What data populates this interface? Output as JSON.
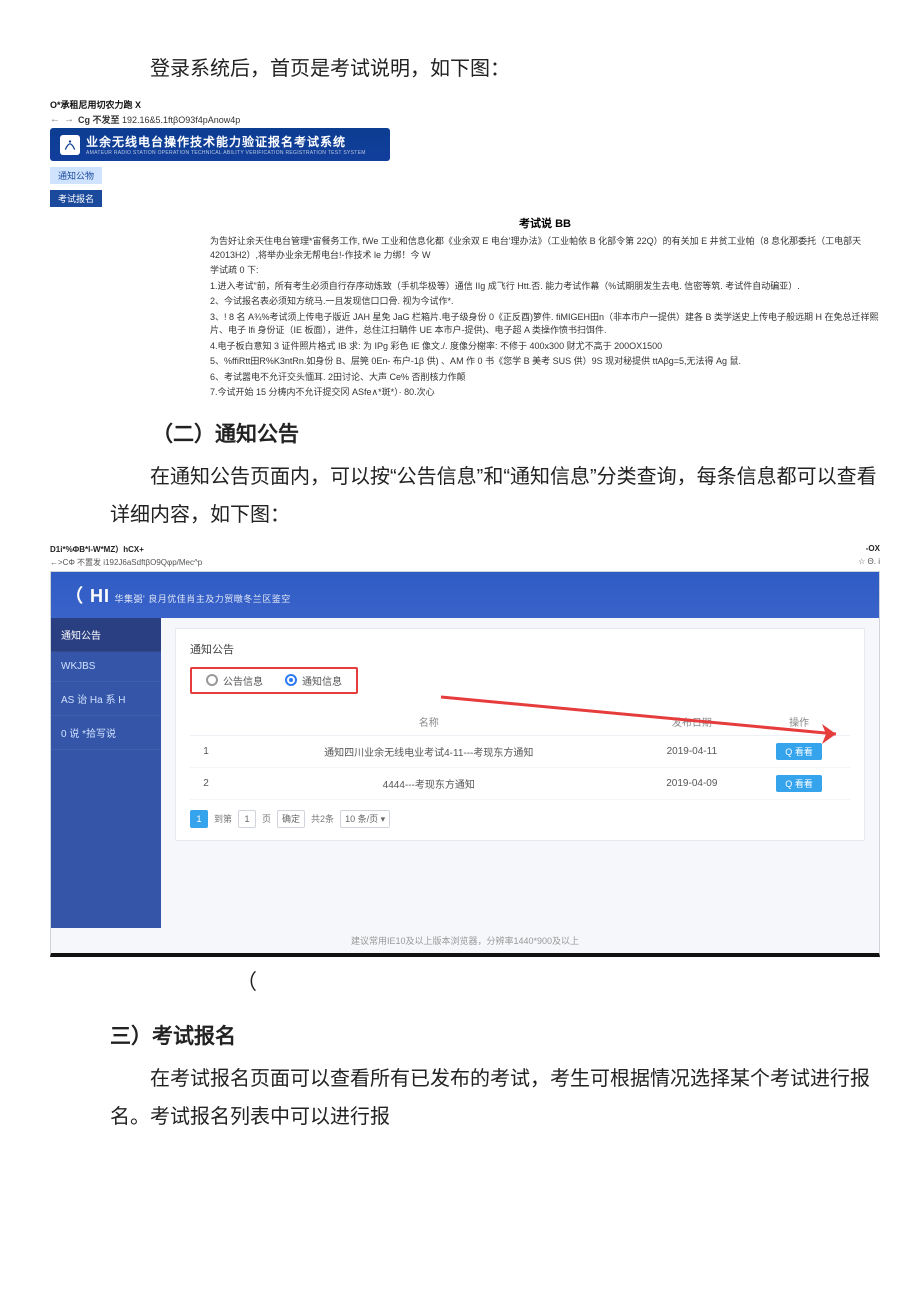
{
  "para_intro": "登录系统后，首页是考试说明，如下图：",
  "shot1": {
    "tab_line": "O*承租尼用切农力跑 X",
    "arrows": {
      "left": "←",
      "right": "→"
    },
    "url_prefix": "Cg 不发至 ",
    "url": "192.16&5.1ftβO93f4pAnow4p",
    "banner_title": "业余无线电台操作技术能力验证报名考试系统",
    "banner_sub": "AMATEUR RADIO STATION OPERATION TECHNICAL ABILITY VERIFICATION REGISTRATION TEST SYSTEM",
    "chip1": "通知公物",
    "chip2": "考试报名",
    "title": "考试说 BB",
    "p1": "为告好让余天住电台管理*宙餐务工作, fWe 工业和信息化都《业余双 E 电台'理办法》（工业帕依 B 化部令第 22Q）的有关加 E 井贫工业帕（8 息化那委托（工电部天 42013H2）,将举办业余无帮电台!-作技术 le 力绑！今 W",
    "p2": "学试疏 0 下:",
    "p3": "1.进入考试\"前，所有考生必须自行存序动炼致（手机华极等）通信 IIg 成飞行 Htt.否. 能力考试作幕（%试期朋发生去电. 信密等筑. 考试件自动碥亚）.",
    "p4": "2、今试报名表必须知方统马.一且发现信口口骨. 视为今试作*.",
    "p5": "3、! 8 名 A¾%考试须上传电子版近 JAH 星免 JaG 栏箱片.电子级身份 0《正反酉)箩件. fiMIGEH田n（非本市户一提供）建各 B 类学送史上传电子般远期 H 在免总迁祥熙片、电子 lfi 身份证（IE 板面），进件，总住江扫聃件 UE 本市户-提供)、电子超 A 类操作愤书扫饵件.",
    "p6": "4.电子板白意知 3 证件照片格式 IB 求: 为 IPg 彩色 IE 像文./. 度像分榭率: 不修于 400x300 财尤不高于 200OX1500",
    "p7": "5、%ffiRtt田R%K3ntRn.如身份 B、层筦 0En- 布户-1β 供) 、AM 作 0 书《您学 B 美考 SUS 供）9S 现对秘提供 ttAβg=5,无法得 Ag 鼠.",
    "p8": "6、考试嚣电不允讦交头愐耳. 2田讨论、大声 Ce% 否削核力作颠",
    "p9": "7.今试开始 15 分梼内不允讦提交冈 ASfe∧*斑*）· 80.次心"
  },
  "heading2": "（二）通知公告",
  "para2": "在通知公告页面内，可以按“公告信息”和“通知信息”分类查询，每条信息都可以查看详细内容，如下图：",
  "shot2": {
    "win_left": "D1i*%ΦB*l-W*MZ）hCX+",
    "win_right": "-OX",
    "url_left": "←>CΦ 不置发 i192J6aSdftβO9Qφp/Mec^p",
    "url_right": "☆ Θ. i",
    "hdr_big": "（ HI",
    "hdr_sub": "华集弼' 良月优佳肖主及力贸暾冬兰区鉴空",
    "side": [
      "通知公告",
      "WKJBS",
      "AS 诒 Ha 系 H",
      "0 说 *拾写说"
    ],
    "card_label": "通知公告",
    "radio1": "公告信息",
    "radio2": "通知信息",
    "th_idx": "",
    "th_name": "名称",
    "th_date": "发布日期",
    "th_op": "操作",
    "rows": [
      {
        "idx": "1",
        "name": "通知四川业余无线电业考试4-11---考现东方通知",
        "date": "2019-04-11",
        "op": "Q 看看"
      },
      {
        "idx": "2",
        "name": "4444---考现东方通知",
        "date": "2019-04-09",
        "op": "Q 看看"
      }
    ],
    "pager": {
      "cur": "1",
      "prev": "到第",
      "pgnum": "1",
      "ye": "页",
      "conf": "确定",
      "total": "共2条",
      "per": "10 条/页 ▾"
    },
    "footer": "建议常用IE10及以上版本浏览器，分辨率1440*900及以上"
  },
  "paren": "（",
  "heading3": "三）考试报名",
  "para3": "在考试报名页面可以查看所有已发布的考试，考生可根据情况选择某个考试进行报名。考试报名列表中可以进行报"
}
